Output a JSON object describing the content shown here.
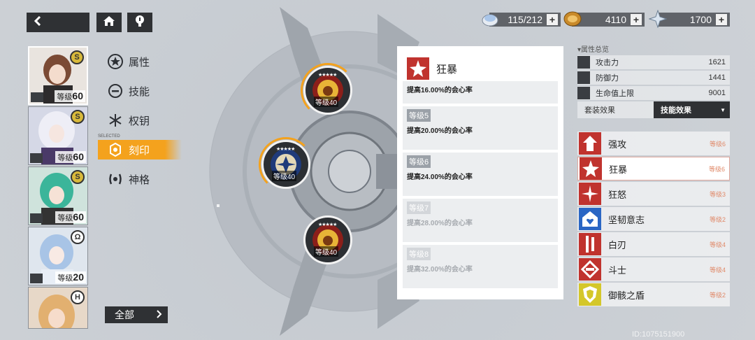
{
  "header": {
    "back_icon": "chevron-left-icon",
    "home_icon": "home-icon",
    "hint_icon": "lightbulb-icon"
  },
  "currencies": [
    {
      "icon": "stamina-icon",
      "value": "115/212"
    },
    {
      "icon": "coin-icon",
      "value": "4110"
    },
    {
      "icon": "crystal-icon",
      "value": "1700"
    }
  ],
  "characters": [
    {
      "level_label": "等级",
      "level": "60",
      "badge": "S",
      "selected": true
    },
    {
      "level_label": "等级",
      "level": "60",
      "badge": "S",
      "selected": false
    },
    {
      "level_label": "等级",
      "level": "60",
      "badge": "S",
      "selected": false
    },
    {
      "level_label": "等级",
      "level": "20",
      "badge": "Ω",
      "selected": false
    },
    {
      "level_label": "",
      "level": "",
      "badge": "H",
      "selected": false
    }
  ],
  "menu": {
    "items": [
      {
        "label": "属性",
        "icon": "star-circle-icon",
        "active": false
      },
      {
        "label": "技能",
        "icon": "minus-circle-icon",
        "active": false
      },
      {
        "label": "权钥",
        "icon": "snowflake-icon",
        "active": false
      },
      {
        "label": "刻印",
        "icon": "seal-icon",
        "active": true
      },
      {
        "label": "神格",
        "icon": "deity-icon",
        "active": false
      }
    ],
    "active_small_label": "SELECTED",
    "all_button": "全部"
  },
  "nodes": [
    {
      "stars": "★★★★★",
      "level": "等级40"
    },
    {
      "stars": "★★★★★",
      "level": "等级40"
    },
    {
      "stars": "★★★★★",
      "level": "等级40"
    }
  ],
  "detail": {
    "name": "狂暴",
    "levels": [
      {
        "tag": "",
        "desc": "提高16.00%的会心率"
      },
      {
        "tag": "等级5",
        "desc": "提高20.00%的会心率"
      },
      {
        "tag": "等级6",
        "desc": "提高24.00%的会心率"
      },
      {
        "tag": "等级7",
        "desc": "提高28.00%的会心率"
      },
      {
        "tag": "等级8",
        "desc": "提高32.00%的会心率"
      }
    ]
  },
  "stats": {
    "title": "▾属性总览",
    "rows": [
      {
        "icon": "attack-icon",
        "label": "攻击力",
        "value": "1621"
      },
      {
        "icon": "defense-icon",
        "label": "防御力",
        "value": "1441"
      },
      {
        "icon": "heart-icon",
        "label": "生命值上限",
        "value": "9001"
      }
    ],
    "tab_set": "套装效果",
    "tab_skill": "技能效果"
  },
  "skills": [
    {
      "name": "强攻",
      "level": "等级6",
      "color": "#c0332e"
    },
    {
      "name": "狂暴",
      "level": "等级6",
      "color": "#c0332e"
    },
    {
      "name": "狂怒",
      "level": "等级3",
      "color": "#c0332e"
    },
    {
      "name": "坚韧意志",
      "level": "等级2",
      "color": "#2a66c4"
    },
    {
      "name": "白刃",
      "level": "等级4",
      "color": "#c0332e"
    },
    {
      "name": "斗士",
      "level": "等级4",
      "color": "#c0332e"
    },
    {
      "name": "御骸之盾",
      "level": "等级2",
      "color": "#d4c72a"
    }
  ],
  "uid": "ID:1075151900"
}
